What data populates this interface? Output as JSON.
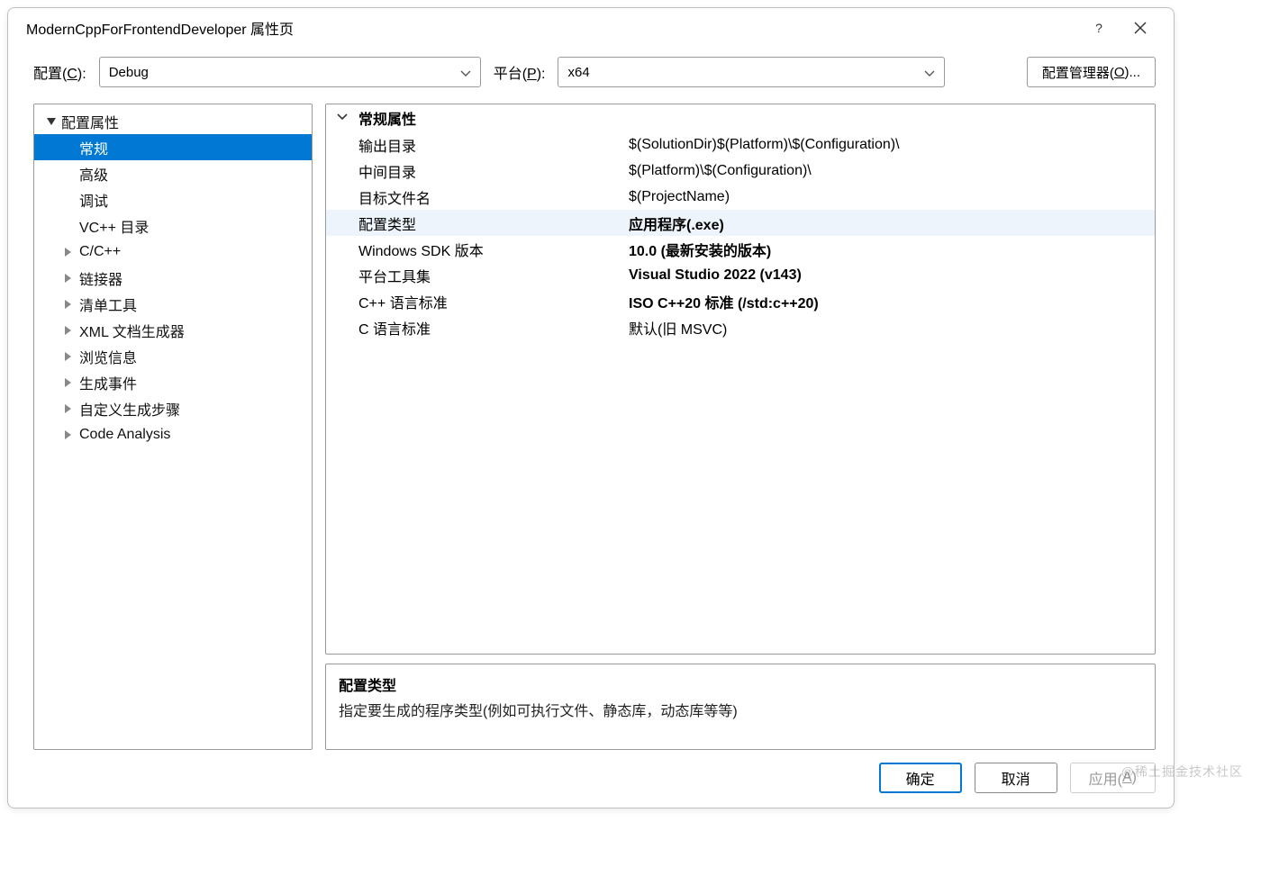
{
  "title": "ModernCppForFrontendDeveloper 属性页",
  "toolbar": {
    "config_label_pre": "配置(",
    "config_label_u": "C",
    "config_label_post": "):",
    "config_value": "Debug",
    "platform_label_pre": "平台(",
    "platform_label_u": "P",
    "platform_label_post": "):",
    "platform_value": "x64",
    "config_mgr_pre": "配置管理器(",
    "config_mgr_u": "O",
    "config_mgr_post": ")..."
  },
  "tree": {
    "root": "配置属性",
    "items": [
      {
        "label": "常规",
        "leaf": true,
        "selected": true
      },
      {
        "label": "高级",
        "leaf": true
      },
      {
        "label": "调试",
        "leaf": true
      },
      {
        "label": "VC++ 目录",
        "leaf": true
      },
      {
        "label": "C/C++",
        "leaf": false
      },
      {
        "label": "链接器",
        "leaf": false
      },
      {
        "label": "清单工具",
        "leaf": false
      },
      {
        "label": "XML 文档生成器",
        "leaf": false
      },
      {
        "label": "浏览信息",
        "leaf": false
      },
      {
        "label": "生成事件",
        "leaf": false
      },
      {
        "label": "自定义生成步骤",
        "leaf": false
      },
      {
        "label": "Code Analysis",
        "leaf": false
      }
    ]
  },
  "grid": {
    "header": "常规属性",
    "rows": [
      {
        "label": "输出目录",
        "value": "$(SolutionDir)$(Platform)\\$(Configuration)\\",
        "bold": false
      },
      {
        "label": "中间目录",
        "value": "$(Platform)\\$(Configuration)\\",
        "bold": false
      },
      {
        "label": "目标文件名",
        "value": "$(ProjectName)",
        "bold": false
      },
      {
        "label": "配置类型",
        "value": "应用程序(.exe)",
        "bold": true,
        "selected": true
      },
      {
        "label": "Windows SDK 版本",
        "value": "10.0 (最新安装的版本)",
        "bold": true
      },
      {
        "label": "平台工具集",
        "value": "Visual Studio 2022 (v143)",
        "bold": true
      },
      {
        "label": "C++ 语言标准",
        "value": "ISO C++20 标准 (/std:c++20)",
        "bold": true
      },
      {
        "label": "C 语言标准",
        "value": "默认(旧 MSVC)",
        "bold": false
      }
    ]
  },
  "description": {
    "title": "配置类型",
    "text": "指定要生成的程序类型(例如可执行文件、静态库，动态库等等)"
  },
  "footer": {
    "ok": "确定",
    "cancel": "取消",
    "apply_pre": "应用(",
    "apply_u": "A",
    "apply_post": ")"
  },
  "watermark": "@稀土掘金技术社区"
}
